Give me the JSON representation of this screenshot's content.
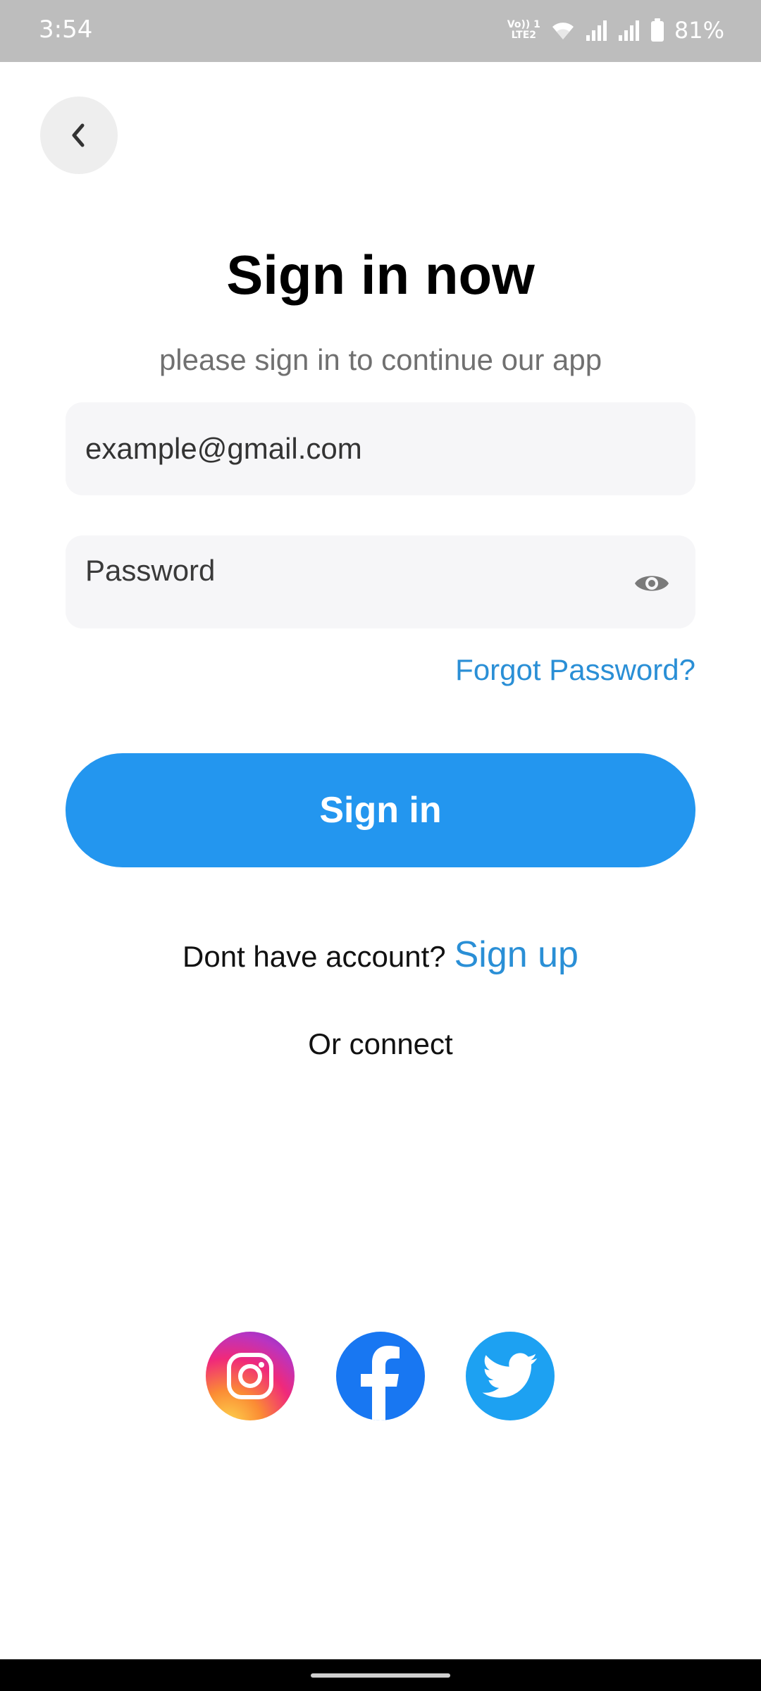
{
  "status_bar": {
    "time": "3:54",
    "volte_line1": "Vo)) 1",
    "volte_line2": "LTE2",
    "battery": "81%",
    "icons": [
      "volte-icon",
      "wifi-icon",
      "signal-icon",
      "signal-icon",
      "battery-icon"
    ]
  },
  "back_button": {
    "icon": "chevron-left-icon"
  },
  "header": {
    "title": "Sign in now",
    "subtitle": "please sign in to continue our app"
  },
  "form": {
    "email_value": "example@gmail.com",
    "email_placeholder": "example@gmail.com",
    "password_placeholder": "Password",
    "password_toggle_icon": "eye-icon",
    "forgot_label": "Forgot Password?",
    "submit_label": "Sign in"
  },
  "signup": {
    "prompt": "Dont have account?",
    "link_label": "Sign up"
  },
  "social": {
    "label": "Or connect",
    "providers": [
      "instagram-icon",
      "facebook-icon",
      "twitter-icon"
    ]
  },
  "colors": {
    "accent": "#2396ef",
    "link": "#2a8fd6",
    "field_bg": "#f6f6f8",
    "status_bar_bg": "#bdbdbd"
  }
}
